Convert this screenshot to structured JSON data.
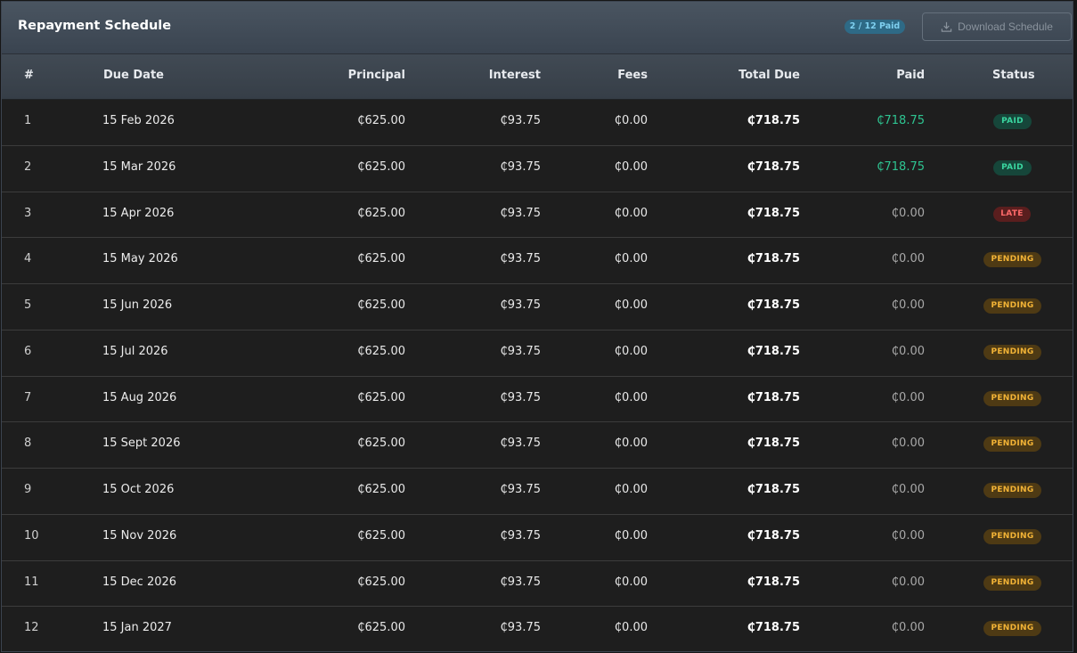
{
  "header": {
    "title": "Repayment Schedule",
    "paid_badge": "2 / 12 Paid",
    "download_label": "Download Schedule"
  },
  "columns": {
    "num": "#",
    "due_date": "Due Date",
    "principal": "Principal",
    "interest": "Interest",
    "fees": "Fees",
    "total_due": "Total Due",
    "paid": "Paid",
    "status": "Status"
  },
  "rows": [
    {
      "num": "1",
      "due_date": "15 Feb 2026",
      "principal": "₵625.00",
      "interest": "₵93.75",
      "fees": "₵0.00",
      "total_due": "₵718.75",
      "paid": "₵718.75",
      "status": "PAID"
    },
    {
      "num": "2",
      "due_date": "15 Mar 2026",
      "principal": "₵625.00",
      "interest": "₵93.75",
      "fees": "₵0.00",
      "total_due": "₵718.75",
      "paid": "₵718.75",
      "status": "PAID"
    },
    {
      "num": "3",
      "due_date": "15 Apr 2026",
      "principal": "₵625.00",
      "interest": "₵93.75",
      "fees": "₵0.00",
      "total_due": "₵718.75",
      "paid": "₵0.00",
      "status": "LATE"
    },
    {
      "num": "4",
      "due_date": "15 May 2026",
      "principal": "₵625.00",
      "interest": "₵93.75",
      "fees": "₵0.00",
      "total_due": "₵718.75",
      "paid": "₵0.00",
      "status": "PENDING"
    },
    {
      "num": "5",
      "due_date": "15 Jun 2026",
      "principal": "₵625.00",
      "interest": "₵93.75",
      "fees": "₵0.00",
      "total_due": "₵718.75",
      "paid": "₵0.00",
      "status": "PENDING"
    },
    {
      "num": "6",
      "due_date": "15 Jul 2026",
      "principal": "₵625.00",
      "interest": "₵93.75",
      "fees": "₵0.00",
      "total_due": "₵718.75",
      "paid": "₵0.00",
      "status": "PENDING"
    },
    {
      "num": "7",
      "due_date": "15 Aug 2026",
      "principal": "₵625.00",
      "interest": "₵93.75",
      "fees": "₵0.00",
      "total_due": "₵718.75",
      "paid": "₵0.00",
      "status": "PENDING"
    },
    {
      "num": "8",
      "due_date": "15 Sept 2026",
      "principal": "₵625.00",
      "interest": "₵93.75",
      "fees": "₵0.00",
      "total_due": "₵718.75",
      "paid": "₵0.00",
      "status": "PENDING"
    },
    {
      "num": "9",
      "due_date": "15 Oct 2026",
      "principal": "₵625.00",
      "interest": "₵93.75",
      "fees": "₵0.00",
      "total_due": "₵718.75",
      "paid": "₵0.00",
      "status": "PENDING"
    },
    {
      "num": "10",
      "due_date": "15 Nov 2026",
      "principal": "₵625.00",
      "interest": "₵93.75",
      "fees": "₵0.00",
      "total_due": "₵718.75",
      "paid": "₵0.00",
      "status": "PENDING"
    },
    {
      "num": "11",
      "due_date": "15 Dec 2026",
      "principal": "₵625.00",
      "interest": "₵93.75",
      "fees": "₵0.00",
      "total_due": "₵718.75",
      "paid": "₵0.00",
      "status": "PENDING"
    },
    {
      "num": "12",
      "due_date": "15 Jan 2027",
      "principal": "₵625.00",
      "interest": "₵93.75",
      "fees": "₵0.00",
      "total_due": "₵718.75",
      "paid": "₵0.00",
      "status": "PENDING"
    }
  ],
  "colors": {
    "paid_green": "#2ec491",
    "late_red": "#ff6a6a",
    "pending_amber": "#f2b336"
  },
  "icons": {
    "download": "download-icon"
  }
}
